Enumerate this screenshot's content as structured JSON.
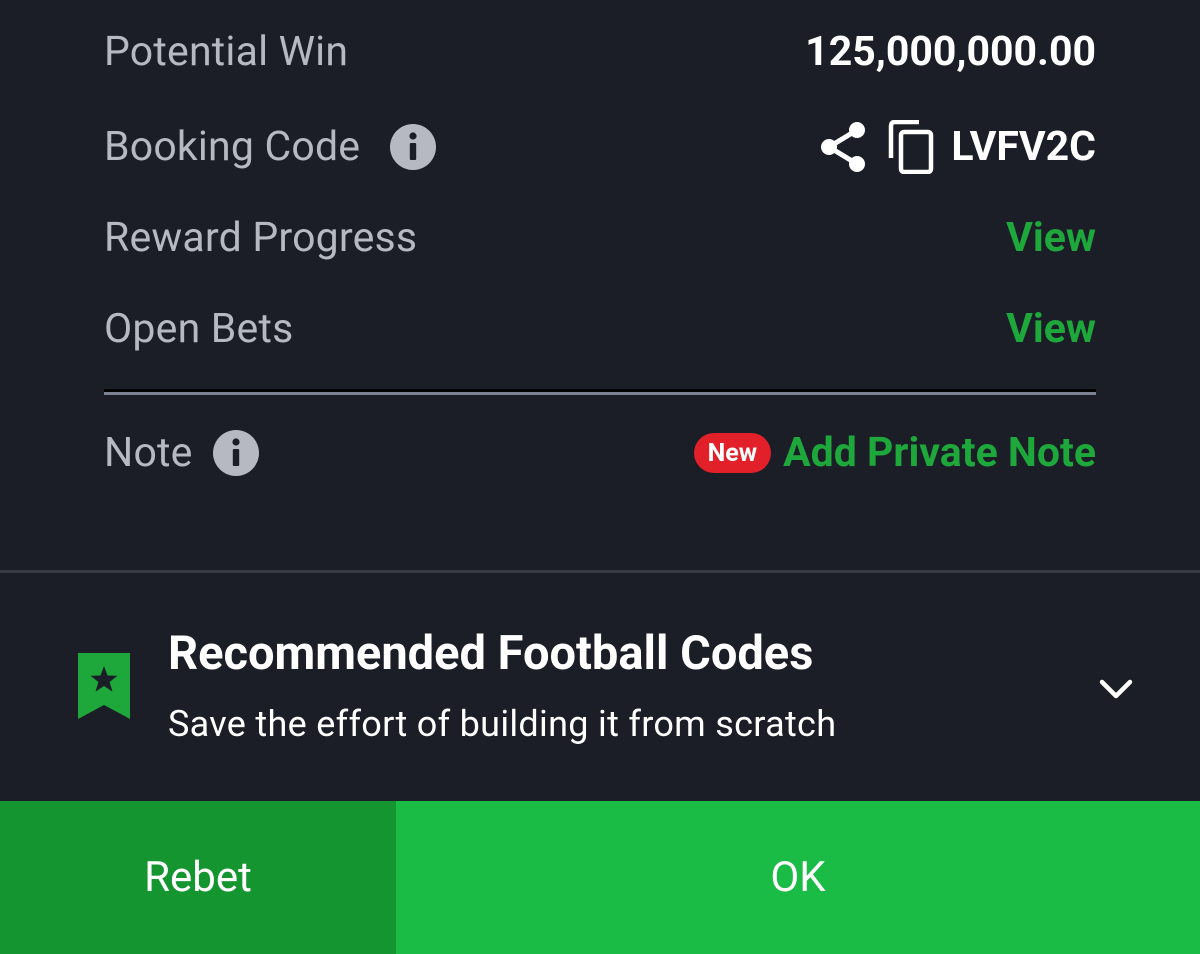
{
  "summary": {
    "potential_win_label": "Potential Win",
    "potential_win_value": "125,000,000.00",
    "booking_code_label": "Booking Code",
    "booking_code_value": "LVFV2C",
    "reward_progress_label": "Reward Progress",
    "reward_progress_link": "View",
    "open_bets_label": "Open Bets",
    "open_bets_link": "View",
    "note_label": "Note",
    "note_badge": "New",
    "note_link": "Add Private Note"
  },
  "recommended": {
    "title": "Recommended Football Codes",
    "subtitle": "Save the effort of building it from scratch",
    "icon": "bookmark-star-icon"
  },
  "actions": {
    "rebet_label": "Rebet",
    "ok_label": "OK"
  },
  "colors": {
    "background": "#1b1e26",
    "accent_green": "#1ea83c",
    "button_dark_green": "#14952f",
    "button_green": "#1abc45",
    "badge_red": "#e2202a"
  }
}
